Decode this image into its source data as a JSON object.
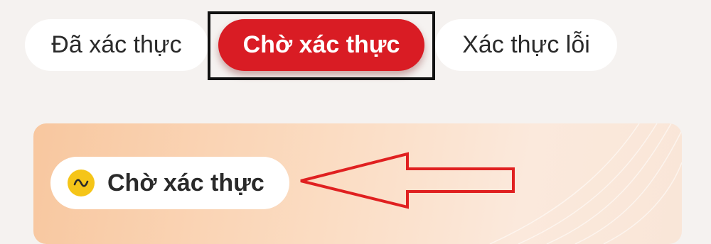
{
  "tabs": [
    {
      "label": "Đã xác thực",
      "selected": false
    },
    {
      "label": "Chờ xác thực",
      "selected": true
    },
    {
      "label": "Xác thực lỗi",
      "selected": false
    }
  ],
  "card": {
    "status_badge": {
      "icon": "pending-wave-icon",
      "label": "Chờ xác thực"
    }
  },
  "colors": {
    "accent": "#d91c24",
    "badge_icon": "#f5c518",
    "annotation_arrow": "#e02020",
    "highlight_box": "#111111"
  }
}
